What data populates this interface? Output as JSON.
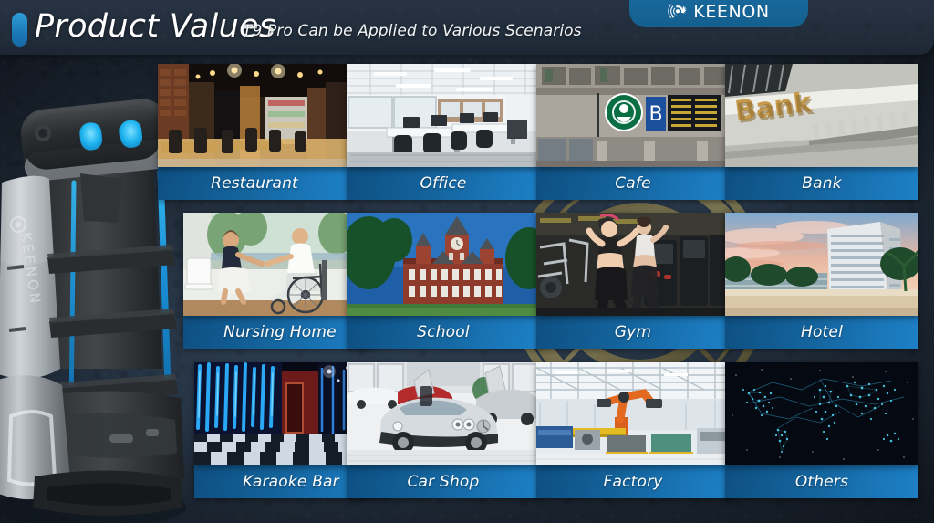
{
  "header": {
    "title_main": "Product Values",
    "title_sub": "T9 Pro Can be Applied to Various Scenarios",
    "brand": "KEENON",
    "brand_icon": "keenon-gear-logo-icon",
    "accent_pill_color": "#1c7cba",
    "logo_tab_color": "#14608f"
  },
  "robot": {
    "name": "T9 Pro delivery robot",
    "body_label": "KEENON",
    "eye_color": "#19b7f0",
    "led_color": "#1e9bdd"
  },
  "background": {
    "base_color": "#1b2430",
    "watermark": "gold-emblem-watermark"
  },
  "grid": {
    "rows": [
      [
        {
          "label": "Restaurant",
          "image": "restaurant-interior-photo"
        },
        {
          "label": "Office",
          "image": "open-plan-office-photo"
        },
        {
          "label": "Cafe",
          "image": "starbucks-cafe-sign-photo"
        },
        {
          "label": "Bank",
          "image": "bank-building-signage-photo"
        }
      ],
      [
        {
          "label": "Nursing Home",
          "image": "caregiver-with-senior-wheelchair-photo"
        },
        {
          "label": "School",
          "image": "brick-school-clocktower-photo"
        },
        {
          "label": "Gym",
          "image": "women-on-treadmills-photo"
        },
        {
          "label": "Hotel",
          "image": "beach-resort-hotel-sunset-photo"
        }
      ],
      [
        {
          "label": "Karaoke Bar",
          "image": "neon-corridor-checkered-floor-photo"
        },
        {
          "label": "Car Shop",
          "image": "silver-sports-cars-showroom-photo"
        },
        {
          "label": "Factory",
          "image": "industrial-robot-assembly-line-photo"
        },
        {
          "label": "Others",
          "image": "world-map-network-nodes-graphic"
        }
      ]
    ]
  }
}
